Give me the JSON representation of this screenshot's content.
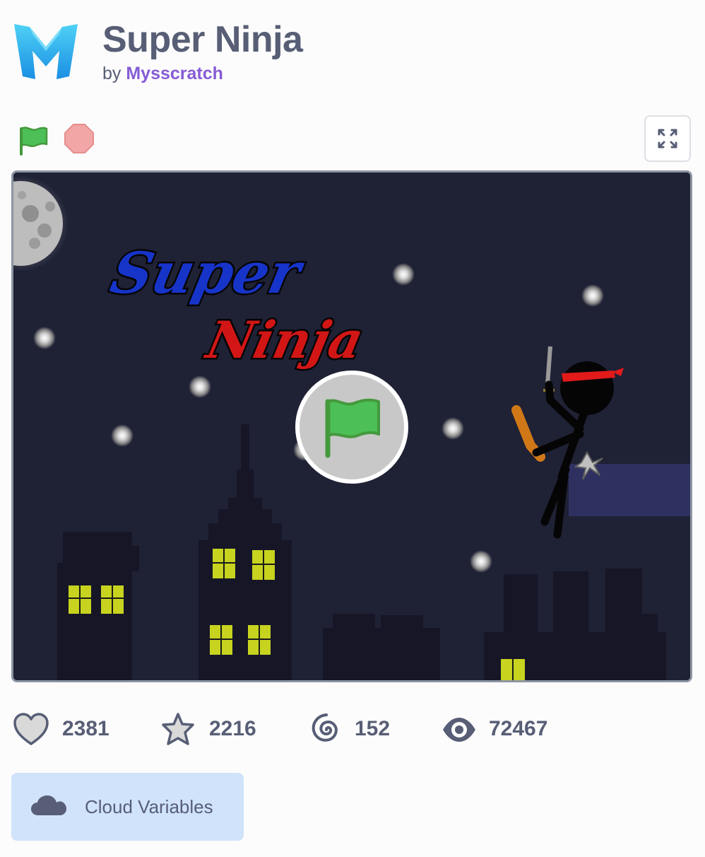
{
  "project": {
    "title": "Super Ninja",
    "by_label": "by",
    "author": "Mysscratch"
  },
  "stage": {
    "title_line1": "Super",
    "title_line2": "Ninja"
  },
  "stats": {
    "loves": "2381",
    "favorites": "2216",
    "remixes": "152",
    "views": "72467"
  },
  "cloud": {
    "label": "Cloud Variables"
  },
  "colors": {
    "text": "#575e75",
    "author": "#855cd6",
    "flag": "#4cbf56",
    "stop": "#f2a6a6",
    "cloud_bg": "#d0e3fb",
    "stage_bg": "#1f2135"
  },
  "icons": {
    "logo": "mysscratch-m-logo",
    "green_flag": "green-flag-icon",
    "stop": "stop-icon",
    "fullscreen": "fullscreen-icon",
    "love": "heart-icon",
    "favorite": "star-icon",
    "remix": "remix-spiral-icon",
    "views": "eye-icon",
    "cloud": "cloud-icon"
  }
}
